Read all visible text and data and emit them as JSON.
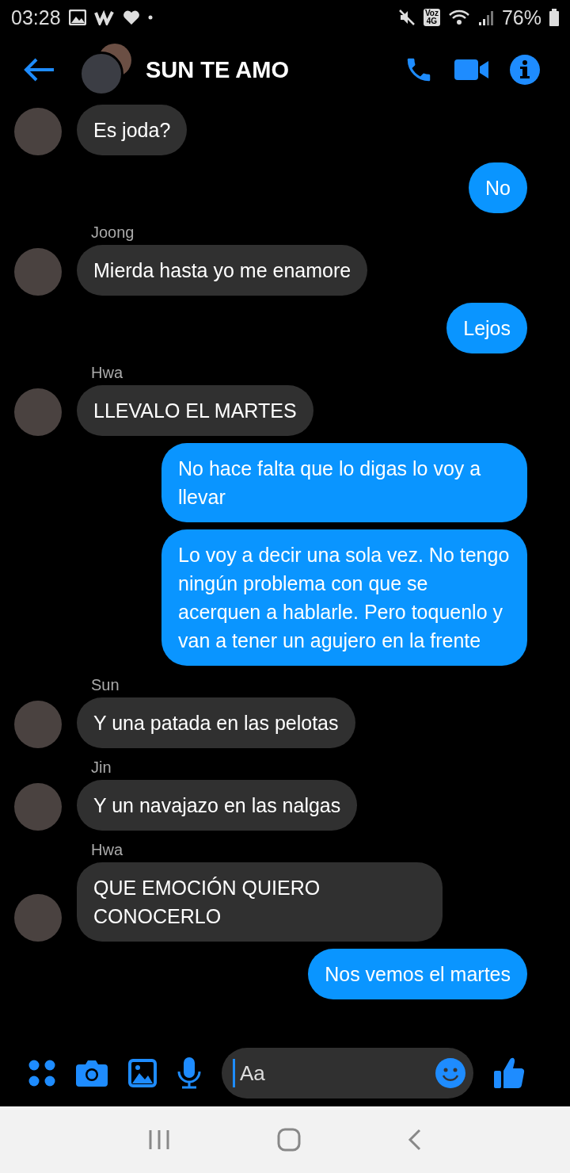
{
  "status_bar": {
    "time": "03:28",
    "network_badge": [
      "Voz",
      "4G"
    ],
    "battery": "76%"
  },
  "header": {
    "title": "SUN TE AMO"
  },
  "messages": [
    {
      "kind": "incoming",
      "text": "Es joda?"
    },
    {
      "kind": "outgoing",
      "text": "No"
    },
    {
      "kind": "incoming",
      "sender": "Joong",
      "text": "Mierda hasta yo me enamore"
    },
    {
      "kind": "outgoing",
      "text": "Lejos"
    },
    {
      "kind": "incoming",
      "sender": "Hwa",
      "text": "LLEVALO EL MARTES"
    },
    {
      "kind": "outgoing",
      "text": "No hace falta que lo digas lo voy a llevar"
    },
    {
      "kind": "outgoing",
      "text": "Lo voy a decir una sola vez. No tengo ningún problema con que se acerquen a hablarle. Pero toquenlo y van a tener un agujero en la frente"
    },
    {
      "kind": "incoming",
      "sender": "Sun",
      "text": "Y una patada en las pelotas"
    },
    {
      "kind": "incoming",
      "sender": "Jin",
      "text": "Y un navajazo en las nalgas"
    },
    {
      "kind": "incoming",
      "sender": "Hwa",
      "text": "QUE EMOCIÓN QUIERO CONOCERLO"
    },
    {
      "kind": "outgoing",
      "text": "Nos vemos el martes"
    }
  ],
  "composer": {
    "placeholder": "Aa"
  }
}
